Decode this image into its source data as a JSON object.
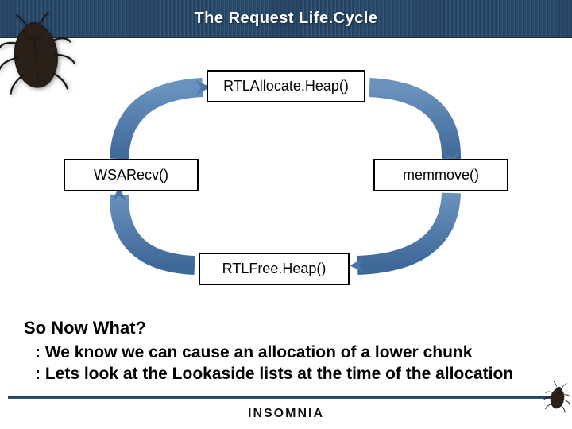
{
  "banner": {
    "title": "The Request Life.Cycle"
  },
  "diagram": {
    "top": "RTLAllocate.Heap()",
    "right": "memmove()",
    "bottom": "RTLFree.Heap()",
    "left": "WSARecv()"
  },
  "body": {
    "heading": "So Now What?",
    "bullets": [
      "We know we can cause an allocation of a lower chunk",
      "Lets look at the Lookaside lists at the time of the allocation"
    ]
  },
  "footer": {
    "brand": "INSOMNIA"
  }
}
